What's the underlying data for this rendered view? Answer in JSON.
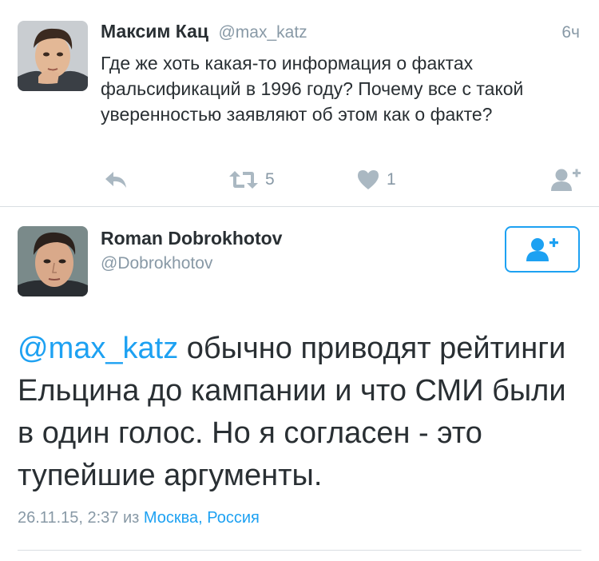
{
  "context_tweet": {
    "author_name": "Максим Кац",
    "author_handle": "@max_katz",
    "time": "6ч",
    "text": "Где же хоть какая-то информация о фактах фальсификаций в 1996 году? Почему все с такой уверенностью заявляют об этом как о факте?",
    "retweet_count": "5",
    "like_count": "1"
  },
  "main_tweet": {
    "author_name": "Roman Dobrokhotov",
    "author_handle": "@Dobrokhotov",
    "mention": "@max_katz",
    "text": " обычно приводят рейтинги Ельцина до кампании и что СМИ были в один голос. Но я согласен - это тупейшие аргументы.",
    "timestamp": "26.11.15, 2:37",
    "from_word": "из",
    "location": "Москва, Россия"
  },
  "icons": {
    "reply": "reply-icon",
    "retweet": "retweet-icon",
    "like": "heart-icon",
    "follow": "follow-icon"
  },
  "colors": {
    "link_blue": "#1da1f2",
    "meta_gray": "#8899a6",
    "text_dark": "#292f33",
    "icon_gray": "#aab8c2"
  }
}
